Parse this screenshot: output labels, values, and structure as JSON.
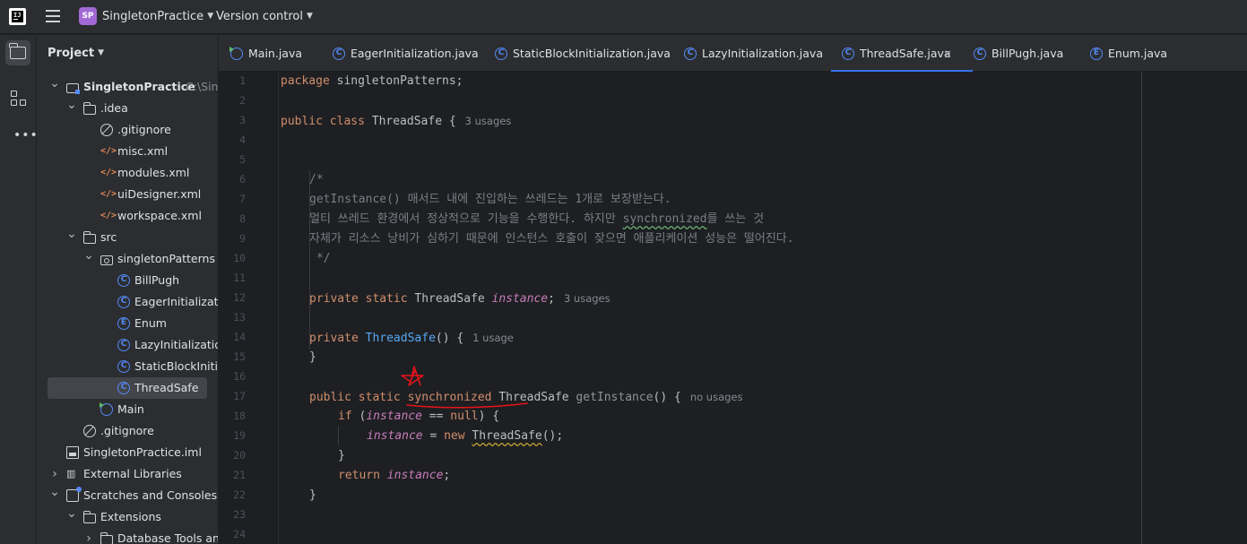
{
  "titlebar": {
    "logo_text": "IJ",
    "project_badge": "SP",
    "project_name": "SingletonPractice",
    "vcs_label": "Version control"
  },
  "project_panel": {
    "header": "Project",
    "tree": [
      {
        "label": "SingletonPractice",
        "hint": "C:\\Sing",
        "icon": "project-folder-icon",
        "arrow": "down"
      },
      {
        "label": ".idea",
        "icon": "folder-icon",
        "arrow": "down"
      },
      {
        "label": ".gitignore",
        "icon": "gitignore-icon"
      },
      {
        "label": "misc.xml",
        "icon": "xml-icon"
      },
      {
        "label": "modules.xml",
        "icon": "xml-icon"
      },
      {
        "label": "uiDesigner.xml",
        "icon": "xml-icon"
      },
      {
        "label": "workspace.xml",
        "icon": "xml-icon"
      },
      {
        "label": "src",
        "icon": "folder-icon",
        "arrow": "down"
      },
      {
        "label": "singletonPatterns",
        "icon": "package-icon",
        "arrow": "down"
      },
      {
        "label": "BillPugh",
        "icon": "class-icon"
      },
      {
        "label": "EagerInitialization",
        "icon": "class-icon"
      },
      {
        "label": "Enum",
        "icon": "enum-icon"
      },
      {
        "label": "LazyInitialization",
        "icon": "class-icon"
      },
      {
        "label": "StaticBlockInitializ",
        "icon": "class-icon"
      },
      {
        "label": "ThreadSafe",
        "icon": "class-icon",
        "selected": true
      },
      {
        "label": "Main",
        "icon": "main-class-icon"
      },
      {
        "label": ".gitignore",
        "icon": "gitignore-icon"
      },
      {
        "label": "SingletonPractice.iml",
        "icon": "iml-icon"
      },
      {
        "label": "External Libraries",
        "icon": "library-icon",
        "arrow": "right"
      },
      {
        "label": "Scratches and Consoles",
        "icon": "scratch-icon",
        "arrow": "down"
      },
      {
        "label": "Extensions",
        "icon": "folder-icon",
        "arrow": "down"
      },
      {
        "label": "Database Tools and S",
        "icon": "folder-icon",
        "arrow": "right"
      }
    ]
  },
  "tabs": [
    {
      "label": "Main.java",
      "icon": "main-class-icon"
    },
    {
      "label": "EagerInitialization.java",
      "icon": "class-icon"
    },
    {
      "label": "StaticBlockInitialization.java",
      "icon": "class-icon"
    },
    {
      "label": "LazyInitialization.java",
      "icon": "class-icon"
    },
    {
      "label": "ThreadSafe.java",
      "icon": "class-icon",
      "active": true,
      "close": "×"
    },
    {
      "label": "BillPugh.java",
      "icon": "class-icon"
    },
    {
      "label": "Enum.java",
      "icon": "enum-icon"
    }
  ],
  "editor": {
    "line_numbers": [
      "1",
      "2",
      "3",
      "4",
      "5",
      "6",
      "7",
      "8",
      "9",
      "10",
      "11",
      "12",
      "13",
      "14",
      "15",
      "16",
      "17",
      "18",
      "19",
      "20",
      "21",
      "22",
      "23",
      "24"
    ],
    "code": {
      "l1_kw": "package",
      "l1_rest": " singletonPatterns;",
      "l3_kw": "public class",
      "l3_cls": " ThreadSafe",
      "l3_rest": " {",
      "l3_hint": "3 usages",
      "l6": "/*",
      "l7": "getInstance() 매서드 내에 진입하는 쓰레드는 1개로 보장받는다.",
      "l8_a": "멀티 쓰레드 환경에서 정상적으로 기능을 수행한다. 하지만 ",
      "l8_b": "synchronized",
      "l8_c": "를 쓰는 것",
      "l9": "자체가 리소스 낭비가 심하기 때문에 인스턴스 호출이 잦으면 애플리케이션 성능은 떨어진다.",
      "l10": " */",
      "l12_kw": "private static",
      "l12_cls": " ThreadSafe ",
      "l12_inst": "instance",
      "l12_rest": ";",
      "l12_hint": "3 usages",
      "l14_kw": "private",
      "l14_fn": " ThreadSafe",
      "l14_rest": "() {",
      "l14_hint": "1 usage",
      "l15": "}",
      "l17_kw": "public static ",
      "l17_sync": "synchronized",
      "l17_cls": " ThreadSafe ",
      "l17_fn": "getInstance",
      "l17_rest": "() {",
      "l17_hint": "no usages",
      "l18_kw": "if",
      "l18_a": " (",
      "l18_inst": "instance",
      "l18_b": " == ",
      "l18_null": "null",
      "l18_c": ") {",
      "l19_inst": "instance",
      "l19_a": " = ",
      "l19_new": "new",
      "l19_sp": " ",
      "l19_cls": "ThreadSafe",
      "l19_b": "();",
      "l20": "}",
      "l21_kw": "return",
      "l21_sp": " ",
      "l21_inst": "instance",
      "l21_rest": ";",
      "l22": "}"
    }
  },
  "colors": {
    "keyword": "#cf8e6d",
    "field": "#c77dbb",
    "method": "#56a8f5",
    "comment": "#7a7e85",
    "accent": "#3574f0",
    "annotation": "#e8141a"
  }
}
